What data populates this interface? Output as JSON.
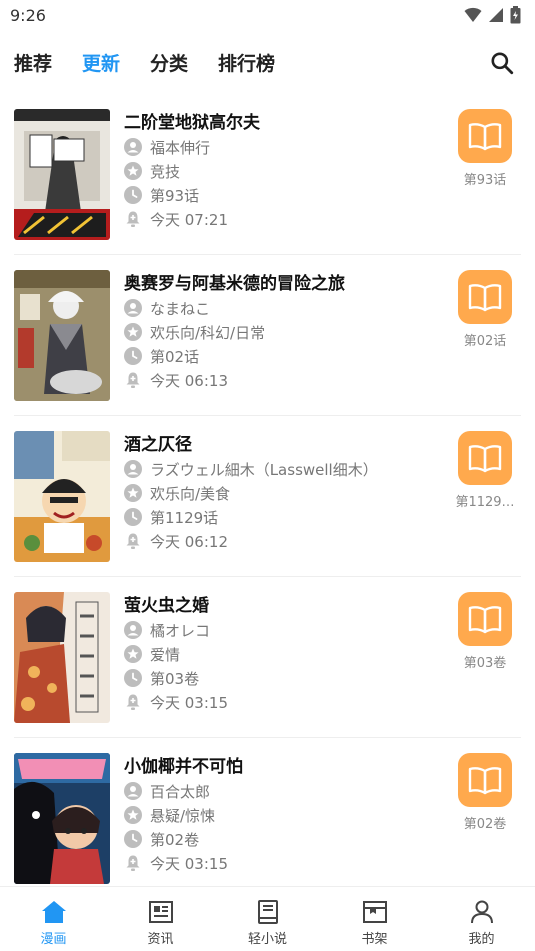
{
  "status": {
    "time": "9:26"
  },
  "tabs": [
    {
      "label": "推荐",
      "active": false
    },
    {
      "label": "更新",
      "active": true
    },
    {
      "label": "分类",
      "active": false
    },
    {
      "label": "排行榜",
      "active": false
    }
  ],
  "colors": {
    "accent": "#2196f3",
    "read_button": "#ffa94d",
    "meta_icon": "#bdbdbd"
  },
  "items": [
    {
      "title": "二阶堂地狱高尔夫",
      "author": "福本伸行",
      "genre": "竞技",
      "chapter": "第93话",
      "updated": "今天 07:21",
      "read_label": "第93话"
    },
    {
      "title": "奥赛罗与阿基米德的冒险之旅",
      "author": "なまねこ",
      "genre": "欢乐向/科幻/日常",
      "chapter": "第02话",
      "updated": "今天 06:13",
      "read_label": "第02话"
    },
    {
      "title": "酒之仄径",
      "author": "ラズウェル細木（Lasswell细木）",
      "genre": "欢乐向/美食",
      "chapter": "第1129话",
      "updated": "今天 06:12",
      "read_label": "第1129…"
    },
    {
      "title": "萤火虫之婚",
      "author": "橘オレコ",
      "genre": "爱情",
      "chapter": "第03卷",
      "updated": "今天 03:15",
      "read_label": "第03卷"
    },
    {
      "title": "小伽椰并不可怕",
      "author": "百合太郎",
      "genre": "悬疑/惊悚",
      "chapter": "第02卷",
      "updated": "今天 03:15",
      "read_label": "第02卷"
    }
  ],
  "bottom_nav": [
    {
      "label": "漫画",
      "icon": "home-icon",
      "active": true
    },
    {
      "label": "资讯",
      "icon": "news-icon",
      "active": false
    },
    {
      "label": "轻小说",
      "icon": "book-icon",
      "active": false
    },
    {
      "label": "书架",
      "icon": "shelf-icon",
      "active": false
    },
    {
      "label": "我的",
      "icon": "user-icon",
      "active": false
    }
  ]
}
